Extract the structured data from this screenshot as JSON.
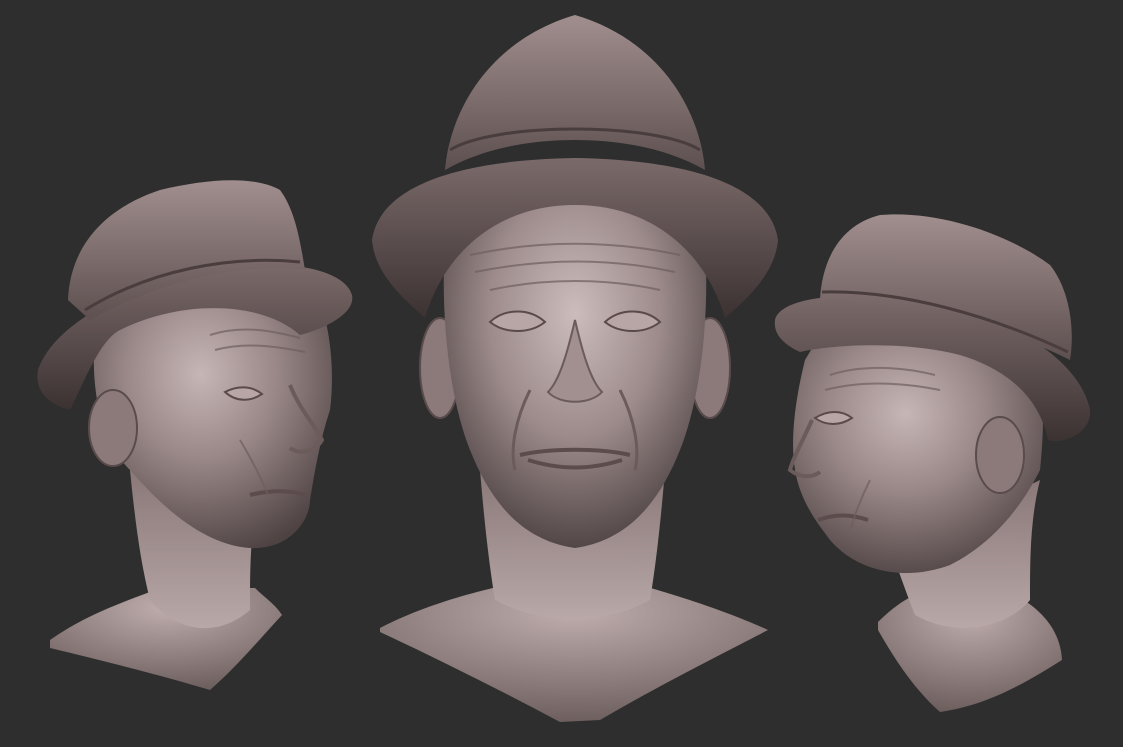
{
  "scene": {
    "subject": "sculpted-head-turnaround",
    "background_color": "#2e2e2e",
    "material_color": "#8a7a7a",
    "views": [
      {
        "name": "left-three-quarter-view",
        "facing": "right"
      },
      {
        "name": "front-view",
        "facing": "front"
      },
      {
        "name": "right-three-quarter-view",
        "facing": "left"
      }
    ]
  }
}
